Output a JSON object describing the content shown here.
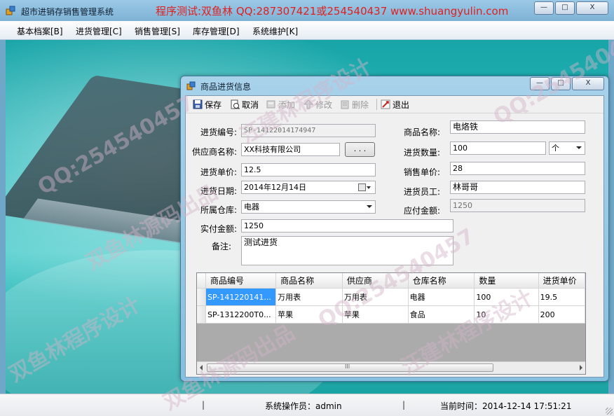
{
  "window": {
    "title": "超市进销存销售管理系统",
    "promo": "程序测试:双鱼林 QQ:287307421或254540437 www.shuangyulin.com",
    "buttons": {
      "minimize": "—",
      "maximize": "□",
      "close": "X"
    }
  },
  "menubar": {
    "items": [
      "基本档案[B]",
      "进货管理[C]",
      "销售管理[S]",
      "库存管理[D]",
      "系统维护[K]"
    ]
  },
  "dialog": {
    "title": "商品进货信息",
    "toolbar": {
      "save": "保存",
      "cancel": "取消",
      "add": "添加",
      "edit": "修改",
      "delete": "删除",
      "exit": "退出"
    },
    "form": {
      "purchase_no_label": "进货编号:",
      "purchase_no": "SP-14122014174947",
      "product_name_label": "商品名称:",
      "product_name": "电烙铁",
      "supplier_label": "供应商名称:",
      "supplier": "XX科技有限公司",
      "supplier_btn": ". . .",
      "quantity_label": "进货数量:",
      "quantity": "100",
      "unit": "个",
      "purchase_price_label": "进货单价:",
      "purchase_price": "12.5",
      "sale_price_label": "销售单价:",
      "sale_price": "28",
      "date_label": "进货日期:",
      "date": "2014年12月14日",
      "clerk_label": "进货员工:",
      "clerk": "林哥哥",
      "warehouse_label": "所属仓库:",
      "warehouse": "电器",
      "payable_label": "应付金额:",
      "payable": "1250",
      "paid_label": "实付金额:",
      "paid": "1250",
      "note_label": "备注:",
      "note": "测试进货"
    },
    "grid": {
      "columns": [
        "商品编号",
        "商品名称",
        "供应商",
        "仓库名称",
        "数量",
        "进货单价"
      ],
      "rows": [
        [
          "SP-141220141...",
          "万用表",
          "万用表",
          "电器",
          "100",
          "19.5"
        ],
        [
          "SP-1312200T0...",
          "苹果",
          "苹果",
          "食品",
          "10",
          "200"
        ]
      ],
      "scroll_grip": "III"
    }
  },
  "statusbar": {
    "sep1": "|",
    "operator": "系统操作员：admin",
    "sep2": "|",
    "time": "当前时间：2014-12-14 17:51:21"
  },
  "watermarks": [
    "双鱼林源码出品",
    "QQ:254540457",
    "汪建林程序设计",
    "QQ:254540457",
    "双鱼林程序设计",
    "汪建林程序设计",
    "QQ:254540457",
    "双鱼林源码出品"
  ],
  "colors": {
    "promo": "#e02020",
    "selection": "#3399ff",
    "desktop": "#1aa3a3"
  }
}
